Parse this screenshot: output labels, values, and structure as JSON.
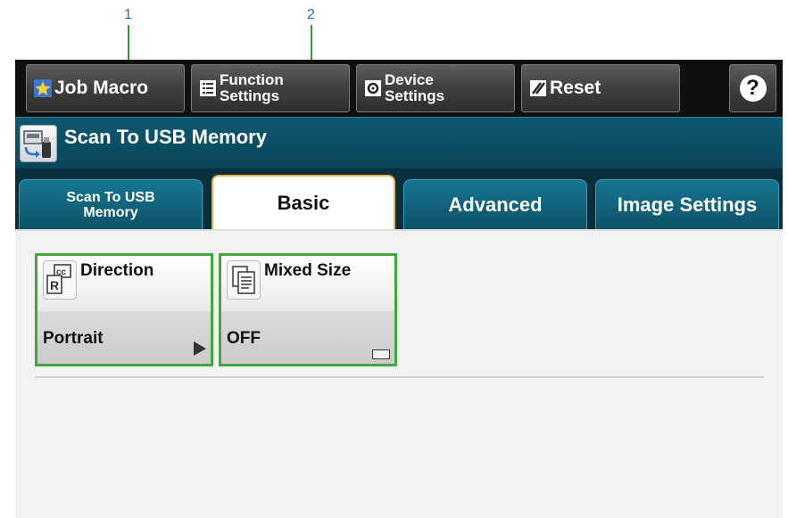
{
  "callouts": [
    "1",
    "2"
  ],
  "toolbar": {
    "job_macro": "Job Macro",
    "function_settings_line1": "Function",
    "function_settings_line2": "Settings",
    "device_settings_line1": "Device",
    "device_settings_line2": "Settings",
    "reset": "Reset",
    "help": "?"
  },
  "header": {
    "title": "Scan To USB Memory"
  },
  "tabs": [
    {
      "line1": "Scan To USB",
      "line2": "Memory",
      "active": false
    },
    {
      "label": "Basic",
      "active": true
    },
    {
      "label": "Advanced",
      "active": false
    },
    {
      "label": "Image Settings",
      "active": false
    }
  ],
  "tiles": [
    {
      "label": "Direction",
      "value": "Portrait",
      "icon": "direction-icon",
      "indicator": "play-arrow"
    },
    {
      "label": "Mixed Size",
      "value": "OFF",
      "icon": "mixed-size-icon",
      "indicator": "toggle-box"
    }
  ],
  "colors": {
    "callout_line": "#3a9a3a",
    "callout_number": "#1f6fb2",
    "header_bg": "#0a4458",
    "tab_active_border": "#f0b347",
    "highlight": "#3fa83f"
  }
}
